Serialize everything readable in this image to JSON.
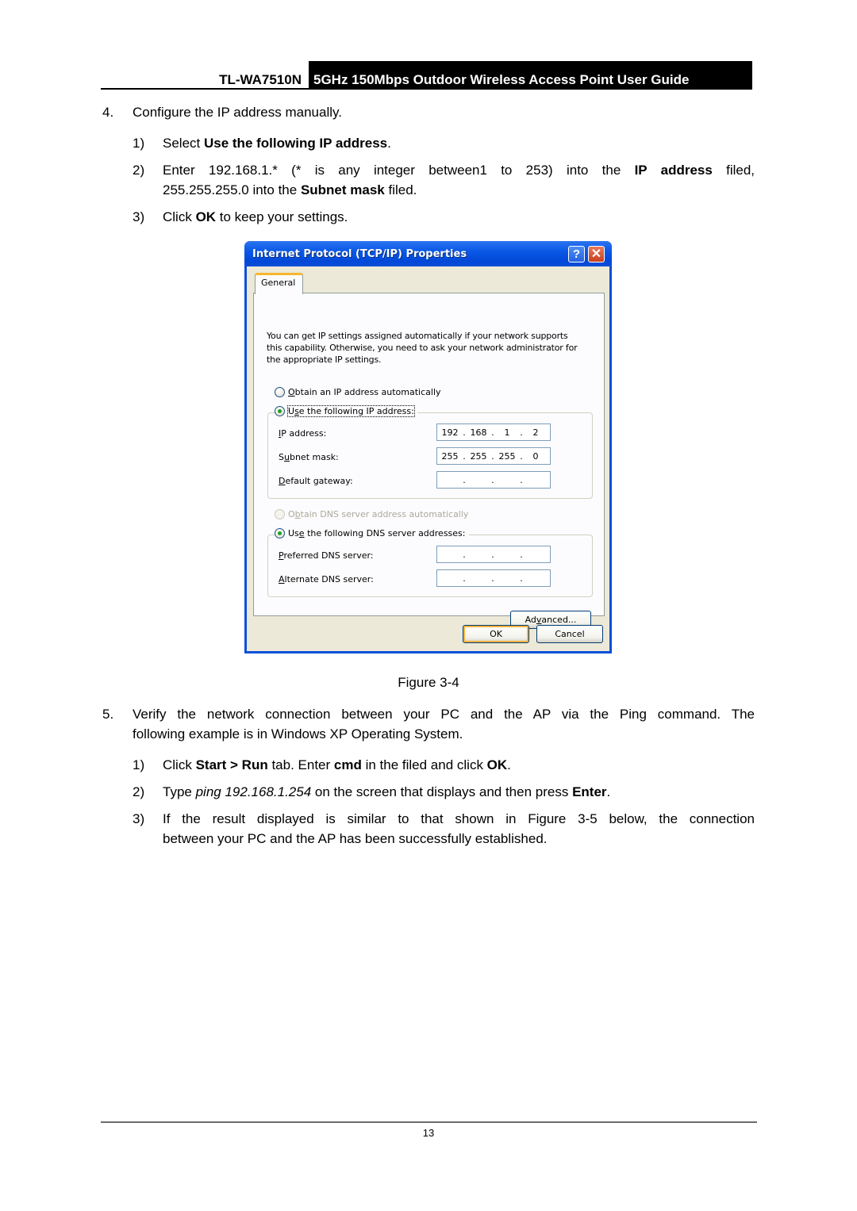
{
  "header": {
    "model": "TL-WA7510N",
    "title": "5GHz 150Mbps Outdoor Wireless Access Point User Guide"
  },
  "steps": {
    "step4": {
      "number": "4.",
      "text": "Configure the IP address manually.",
      "substeps": [
        {
          "number": "1)",
          "pre": "Select ",
          "bold": "Use the following IP address",
          "post": "."
        },
        {
          "number": "2)",
          "line1_pre": "Enter 192.168.1.* (* is any integer between1 to 253) into the ",
          "line1_bold": "IP address",
          "line1_post": " filed,",
          "line2_pre": "255.255.255.0 into the ",
          "line2_bold": "Subnet mask",
          "line2_post": " filed."
        },
        {
          "number": "3)",
          "pre": "Click ",
          "bold": "OK",
          "post": " to keep your settings."
        }
      ]
    },
    "step5": {
      "number": "5.",
      "line1": "Verify the network connection between your PC and the AP via the Ping command. The",
      "line2": "following example is in Windows XP Operating System.",
      "substeps": [
        {
          "number": "1)",
          "t1": "Click ",
          "b1": "Start > Run",
          "t2": " tab. Enter ",
          "b2": "cmd",
          "t3": " in the filed and click ",
          "b3": "OK",
          "t4": "."
        },
        {
          "number": "2)",
          "t1": "Type ",
          "i1": "ping 192.168.1.254",
          "t2": " on the screen that displays and then press ",
          "b1": "Enter",
          "t3": "."
        },
        {
          "number": "3)",
          "line1": "If the result displayed is similar to that shown in Figure 3-5 below, the connection",
          "line2": "between your PC and the AP has been successfully established."
        }
      ]
    }
  },
  "dialog": {
    "title": "Internet Protocol (TCP/IP) Properties",
    "help_glyph": "?",
    "close_glyph": "✕",
    "tab": "General",
    "description": "You can get IP settings assigned automatically if your network supports this capability. Otherwise, you need to ask your network administrator for the appropriate IP settings.",
    "ip_mode": {
      "auto_label_u": "O",
      "auto_label_rest": "btain an IP address automatically",
      "manual_label_pre": "U",
      "manual_label_u": "s",
      "manual_label_rest": "e the following IP address:",
      "selected": "manual"
    },
    "fields": {
      "ip_address": {
        "label_u": "I",
        "label_rest": "P address:",
        "octets": [
          "192",
          "168",
          "1",
          "2"
        ]
      },
      "subnet_mask": {
        "label_pre": "S",
        "label_u": "u",
        "label_rest": "bnet mask:",
        "octets": [
          "255",
          "255",
          "255",
          "0"
        ]
      },
      "default_gateway": {
        "label_u": "D",
        "label_rest": "efault gateway:",
        "octets": [
          "",
          "",
          "",
          ""
        ]
      }
    },
    "dns_mode": {
      "auto_label_pre": "O",
      "auto_label_u": "b",
      "auto_label_rest": "tain DNS server address automatically",
      "manual_label_pre": "Us",
      "manual_label_u": "e",
      "manual_label_rest": " the following DNS server addresses:",
      "selected": "manual",
      "auto_disabled": true
    },
    "dns_fields": {
      "preferred": {
        "label_u": "P",
        "label_rest": "referred DNS server:",
        "octets": [
          "",
          "",
          "",
          ""
        ]
      },
      "alternate": {
        "label_u": "A",
        "label_rest": "lternate DNS server:",
        "octets": [
          "",
          "",
          "",
          ""
        ]
      }
    },
    "advanced_pre": "Ad",
    "advanced_u": "v",
    "advanced_rest": "anced...",
    "ok": "OK",
    "cancel": "Cancel"
  },
  "figure_caption": "Figure 3-4",
  "page_number": "13"
}
